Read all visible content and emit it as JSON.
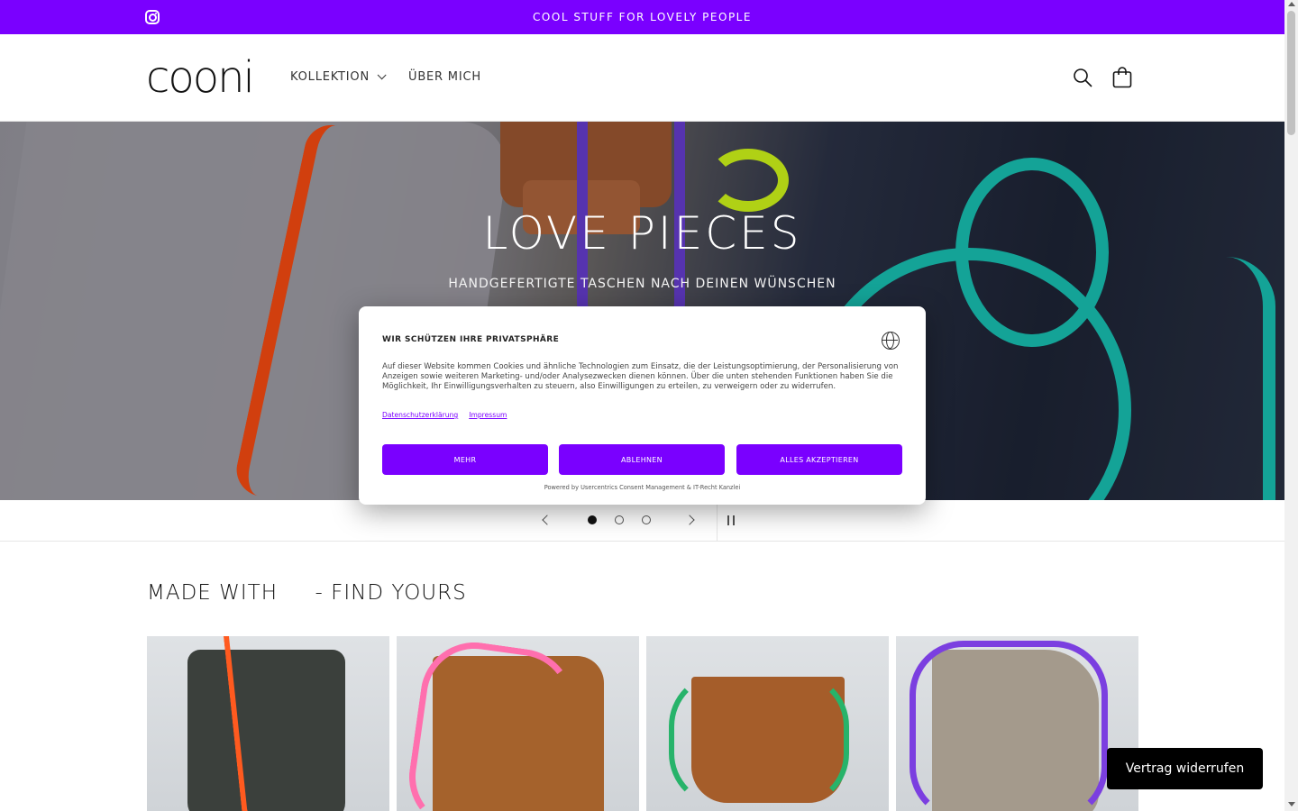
{
  "announcement": {
    "text": "COOL STUFF FOR LOVELY PEOPLE",
    "background": "#7a00ff"
  },
  "header": {
    "logo": "cooni",
    "nav": [
      {
        "label": "KOLLEKTION",
        "has_dropdown": true
      },
      {
        "label": "ÜBER MICH",
        "has_dropdown": false
      }
    ],
    "icons": [
      "search-icon",
      "cart-icon",
      "instagram-icon"
    ]
  },
  "hero": {
    "title": "LOVE PIECES",
    "subtitle": "HANDGEFERTIGTE TASCHEN NACH DEINEN WÜNSCHEN",
    "slides_total": 3,
    "active_slide": 1
  },
  "consent": {
    "title": "WIR SCHÜTZEN IHRE PRIVATSPHÄRE",
    "text": "Auf dieser Website kommen Cookies und ähnliche Technologien zum Einsatz, die der Leistungsoptimierung, der Personalisierung von Anzeigen sowie weiteren Marketing- und/oder Analysezwecken dienen können. Über die unten stehenden Funktionen haben Sie die Möglichkeit, Ihr Einwilligungsverhalten zu steuern, also Einwilligungen zu erteilen, zu verweigern oder zu widerrufen.",
    "links": {
      "privacy": "Datenschutzerklärung",
      "imprint": "Impressum"
    },
    "buttons": {
      "more": "MEHR",
      "decline": "ABLEHNEN",
      "accept_all": "ALLES AKZEPTIEREN"
    },
    "powered_by": "Powered by Usercentrics Consent Management & IT-Recht Kanzlei"
  },
  "section": {
    "title": "MADE WITH     - FIND YOURS",
    "products": [
      {
        "bag_color": "#3b403c",
        "strap_color": "#ff5a1f"
      },
      {
        "bag_color": "#a5622c",
        "strap_color": "#ff6fae"
      },
      {
        "bag_color": "#a55d2a",
        "strap_color": "#27b36a"
      },
      {
        "bag_color": "#a49a8c",
        "strap_color": "#7b3fe0"
      }
    ]
  },
  "floating_button": {
    "label": "Vertrag widerrufen"
  },
  "accent_color": "#7a00ff"
}
